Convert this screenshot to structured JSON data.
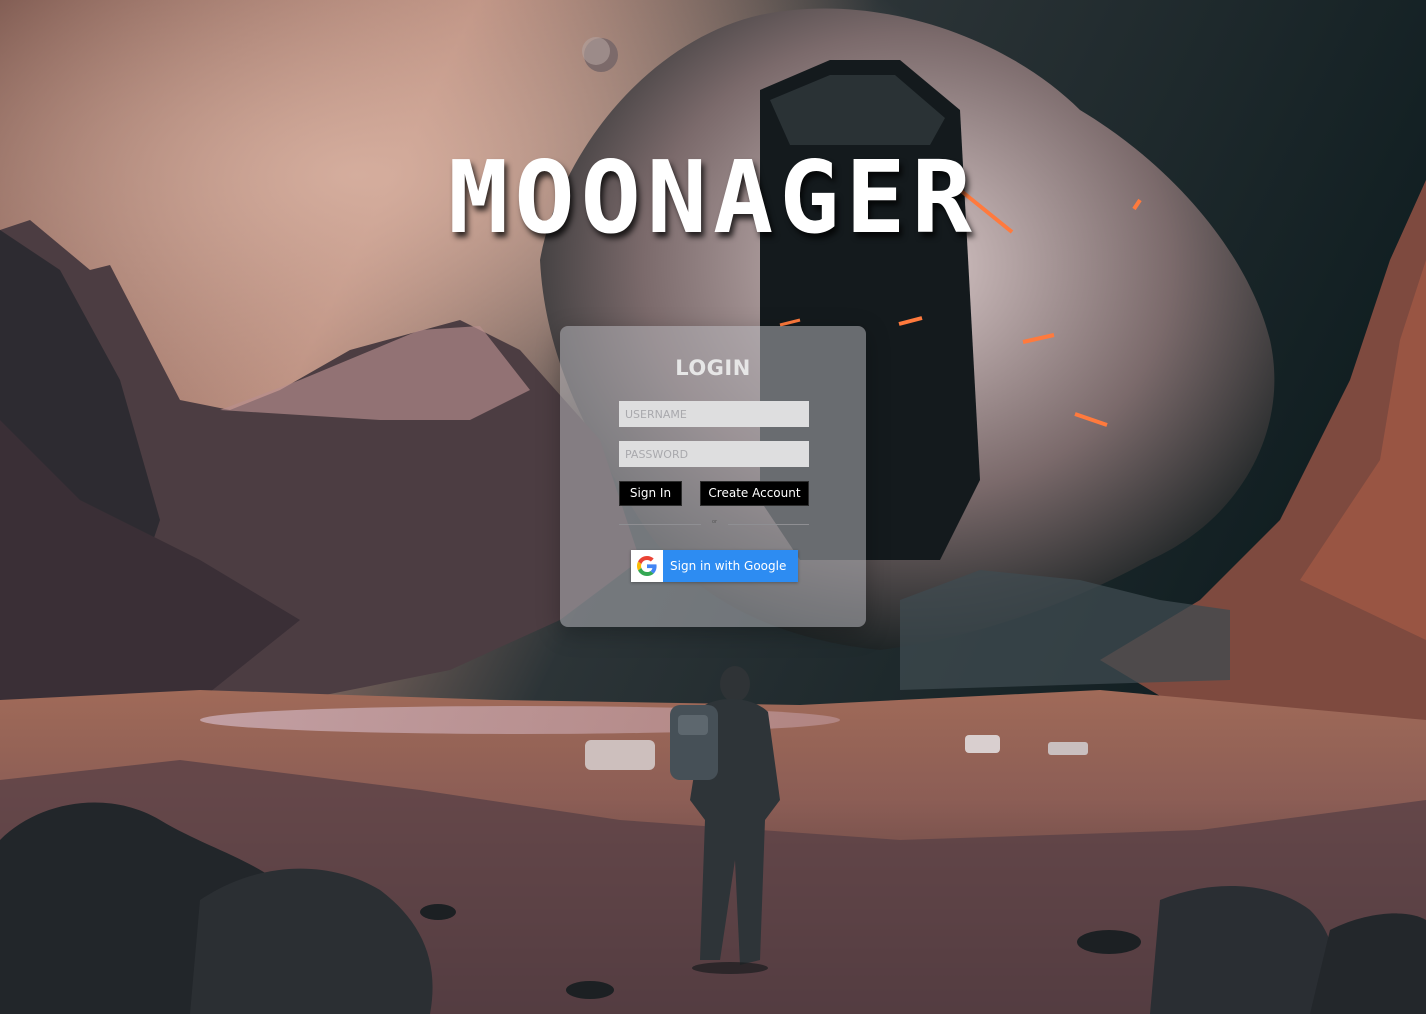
{
  "app": {
    "title": "MOONAGER"
  },
  "login": {
    "heading": "LOGIN",
    "username_placeholder": "USERNAME",
    "password_placeholder": "PASSWORD",
    "sign_in_label": "Sign In",
    "create_account_label": "Create Account",
    "divider_text": "or",
    "google_label": "Sign in with Google",
    "google_icon": "google-g-icon"
  },
  "colors": {
    "card_bg": "#b9b9be",
    "button_dark": "#000000",
    "google_blue": "#2d8cf2",
    "input_bg": "#dededf"
  }
}
